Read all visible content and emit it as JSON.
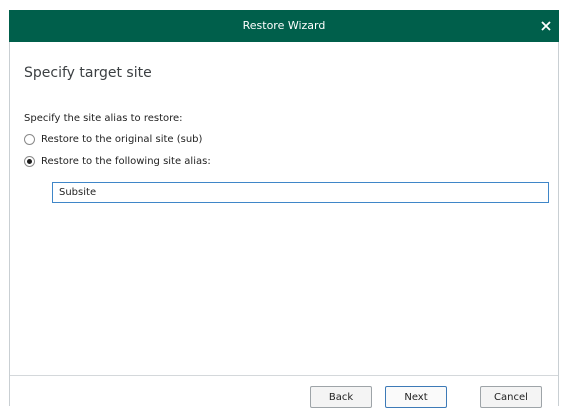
{
  "window": {
    "title": "Restore Wizard",
    "close_icon": "close-icon"
  },
  "page": {
    "title": "Specify target site",
    "prompt": "Specify the site alias to restore:"
  },
  "options": [
    {
      "label": "Restore to the original site (sub)",
      "selected": false
    },
    {
      "label": "Restore to the following site alias:",
      "selected": true
    }
  ],
  "alias_input": {
    "value": "Subsite"
  },
  "buttons": {
    "back": "Back",
    "next": "Next",
    "cancel": "Cancel"
  },
  "colors": {
    "titlebar": "#005f4b",
    "input_border": "#3f86c8"
  }
}
